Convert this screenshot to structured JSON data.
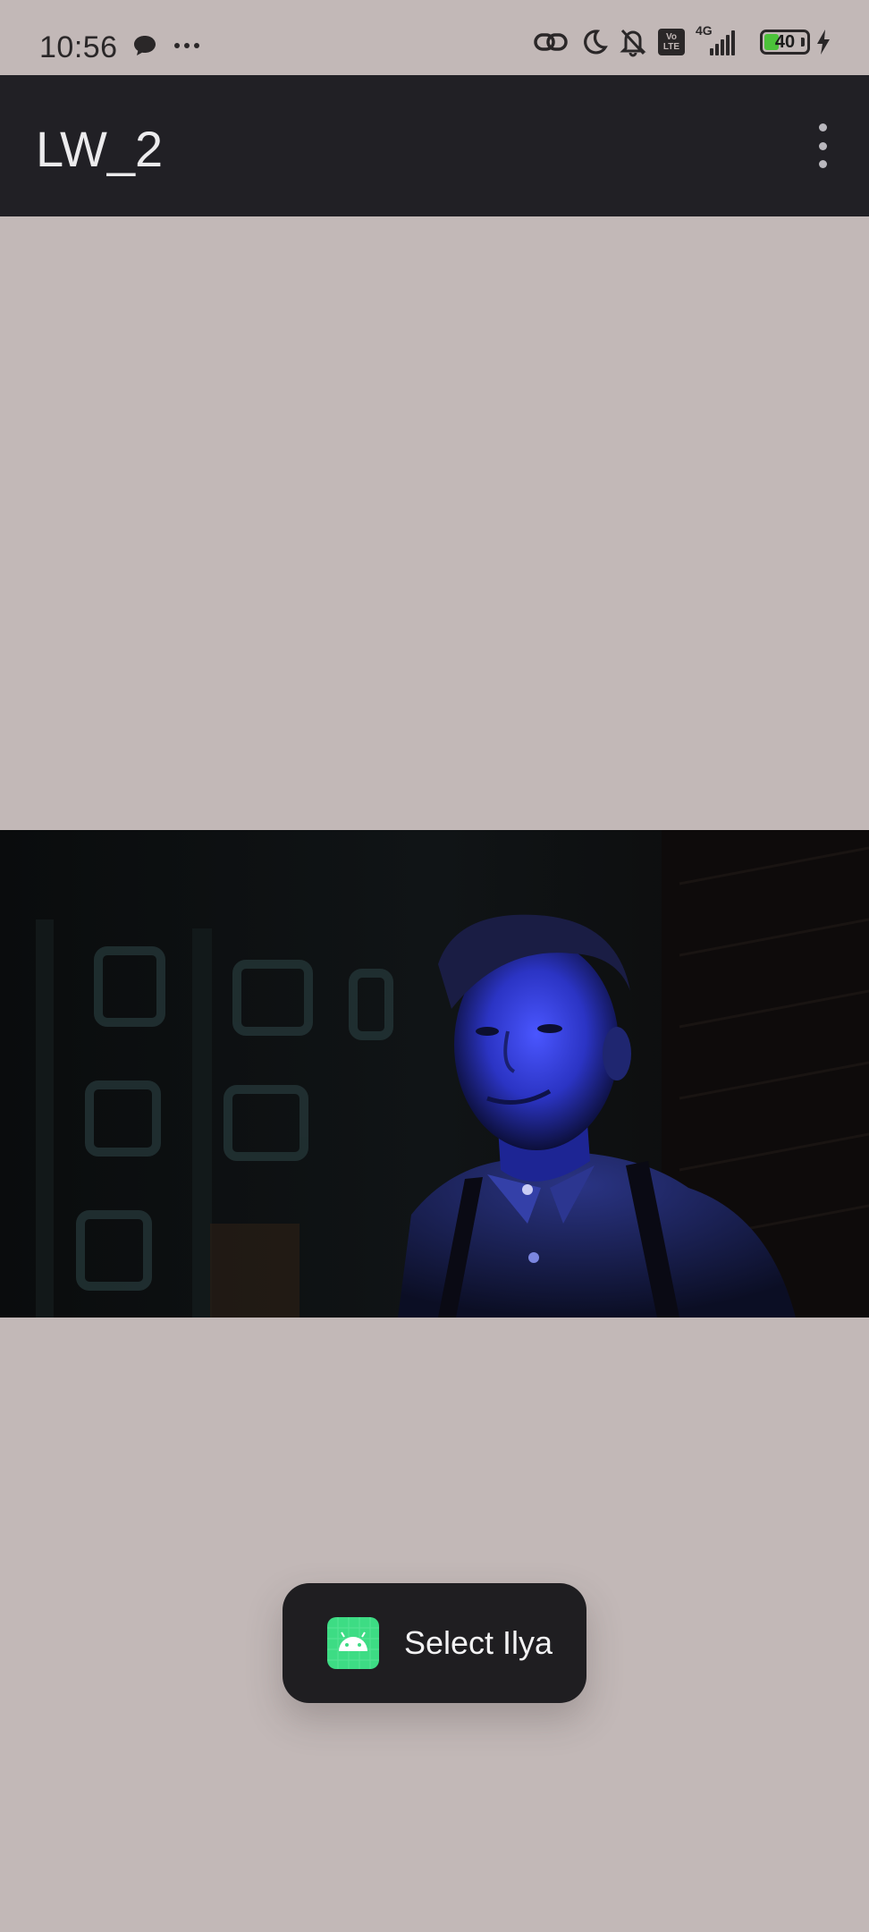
{
  "status_bar": {
    "time": "10:56",
    "left_icons": [
      "chat-bubble-icon",
      "more-dots-icon"
    ],
    "right_icons": [
      "link-icon",
      "moon-icon",
      "bell-off-icon",
      "volte-icon",
      "signal-4g-icon",
      "battery-icon",
      "charging-icon"
    ],
    "volte_top": "Vo",
    "volte_bottom": "LTE",
    "network_type": "4G",
    "battery_level": "40",
    "battery_fraction": 0.4,
    "battery_color": "#4cc23a"
  },
  "app_bar": {
    "title": "LW_2",
    "menu_icon": "overflow-menu-icon",
    "background": "#212025"
  },
  "content": {
    "background": "#c2b8b7",
    "image": "portrait photo of a young man lit by blue light at night"
  },
  "toast": {
    "icon": "android-app-icon",
    "text": "Select Ilya"
  }
}
